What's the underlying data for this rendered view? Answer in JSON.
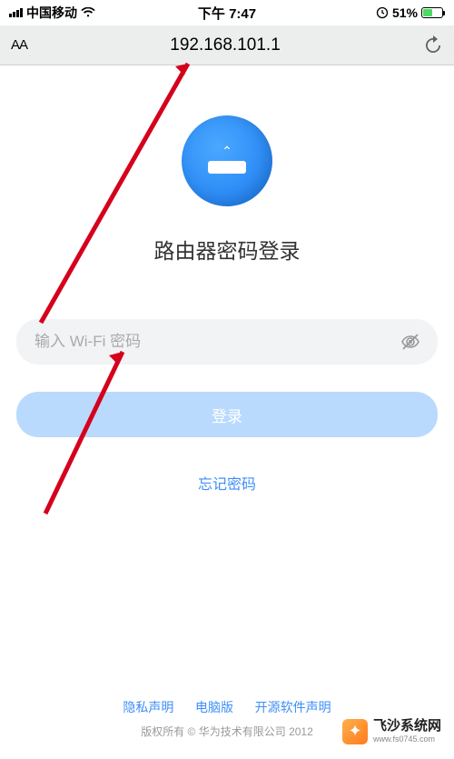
{
  "status": {
    "carrier": "中国移动",
    "time": "下午 7:47",
    "battery_pct": "51%"
  },
  "browser": {
    "text_size_label": "AA",
    "url": "192.168.101.1"
  },
  "login": {
    "title": "路由器密码登录",
    "placeholder": "输入 Wi-Fi 密码",
    "button": "登录",
    "forgot": "忘记密码"
  },
  "footer": {
    "links": [
      "隐私声明",
      "电脑版",
      "开源软件声明"
    ],
    "copyright": "版权所有 © 华为技术有限公司 2012"
  },
  "watermark": {
    "title": "飞沙系统网",
    "sub": "www.fs0745.com"
  }
}
